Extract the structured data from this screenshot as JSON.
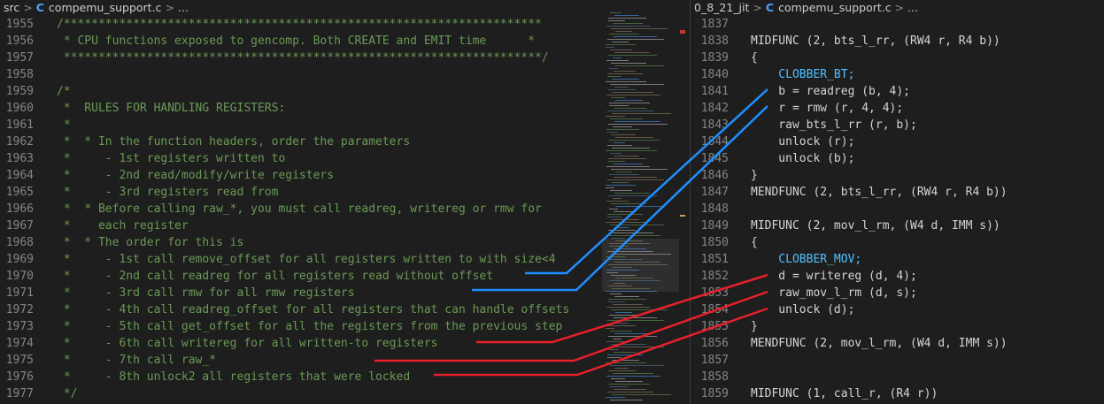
{
  "left": {
    "breadcrumb": [
      "src",
      "compemu_support.c",
      "..."
    ],
    "lines": [
      {
        "n": "1955",
        "t": "/*********************************************************************"
      },
      {
        "n": "1956",
        "t": " * CPU functions exposed to gencomp. Both CREATE and EMIT time      *"
      },
      {
        "n": "1957",
        "t": " *********************************************************************/"
      },
      {
        "n": "1958",
        "t": ""
      },
      {
        "n": "1959",
        "t": "/*"
      },
      {
        "n": "1960",
        "t": " *  RULES FOR HANDLING REGISTERS:"
      },
      {
        "n": "1961",
        "t": " *"
      },
      {
        "n": "1962",
        "t": " *  * In the function headers, order the parameters"
      },
      {
        "n": "1963",
        "t": " *     - 1st registers written to"
      },
      {
        "n": "1964",
        "t": " *     - 2nd read/modify/write registers"
      },
      {
        "n": "1965",
        "t": " *     - 3rd registers read from"
      },
      {
        "n": "1966",
        "t": " *  * Before calling raw_*, you must call readreg, writereg or rmw for"
      },
      {
        "n": "1967",
        "t": " *    each register"
      },
      {
        "n": "1968",
        "t": " *  * The order for this is"
      },
      {
        "n": "1969",
        "t": " *     - 1st call remove_offset for all registers written to with size<4"
      },
      {
        "n": "1970",
        "t": " *     - 2nd call readreg for all registers read without offset"
      },
      {
        "n": "1971",
        "t": " *     - 3rd call rmw for all rmw registers"
      },
      {
        "n": "1972",
        "t": " *     - 4th call readreg_offset for all registers that can handle offsets"
      },
      {
        "n": "1973",
        "t": " *     - 5th call get_offset for all the registers from the previous step"
      },
      {
        "n": "1974",
        "t": " *     - 6th call writereg for all written-to registers"
      },
      {
        "n": "1975",
        "t": " *     - 7th call raw_*"
      },
      {
        "n": "1976",
        "t": " *     - 8th unlock2 all registers that were locked"
      },
      {
        "n": "1977",
        "t": " */"
      }
    ]
  },
  "right": {
    "breadcrumb": [
      "0_8_21_jit",
      "compemu_support.c",
      "..."
    ],
    "lines": [
      {
        "n": "1837",
        "t": ""
      },
      {
        "n": "1838",
        "t": "MIDFUNC (2, bts_l_rr, (RW4 r, R4 b))"
      },
      {
        "n": "1839",
        "t": "{"
      },
      {
        "n": "1840",
        "t": "    CLOBBER_BT;",
        "macro": true
      },
      {
        "n": "1841",
        "t": "    b = readreg (b, 4);"
      },
      {
        "n": "1842",
        "t": "    r = rmw (r, 4, 4);"
      },
      {
        "n": "1843",
        "t": "    raw_bts_l_rr (r, b);"
      },
      {
        "n": "1844",
        "t": "    unlock (r);"
      },
      {
        "n": "1845",
        "t": "    unlock (b);"
      },
      {
        "n": "1846",
        "t": "}"
      },
      {
        "n": "1847",
        "t": "MENDFUNC (2, bts_l_rr, (RW4 r, R4 b))"
      },
      {
        "n": "1848",
        "t": ""
      },
      {
        "n": "1849",
        "t": "MIDFUNC (2, mov_l_rm, (W4 d, IMM s))"
      },
      {
        "n": "1850",
        "t": "{"
      },
      {
        "n": "1851",
        "t": "    CLOBBER_MOV;",
        "macro": true
      },
      {
        "n": "1852",
        "t": "    d = writereg (d, 4);"
      },
      {
        "n": "1853",
        "t": "    raw_mov_l_rm (d, s);"
      },
      {
        "n": "1854",
        "t": "    unlock (d);"
      },
      {
        "n": "1855",
        "t": "}"
      },
      {
        "n": "1856",
        "t": "MENDFUNC (2, mov_l_rm, (W4 d, IMM s))"
      },
      {
        "n": "1857",
        "t": ""
      },
      {
        "n": "1858",
        "t": ""
      },
      {
        "n": "1859",
        "t": "MIDFUNC (1, call_r, (R4 r))"
      }
    ]
  },
  "colors": {
    "background": "#1e1e1e",
    "comment": "#6a9955",
    "code": "#d4d4d4",
    "macro": "#4fc1ff",
    "line_number": "#858585",
    "annotation_blue": "#1e90ff",
    "annotation_red": "#e8202a"
  }
}
